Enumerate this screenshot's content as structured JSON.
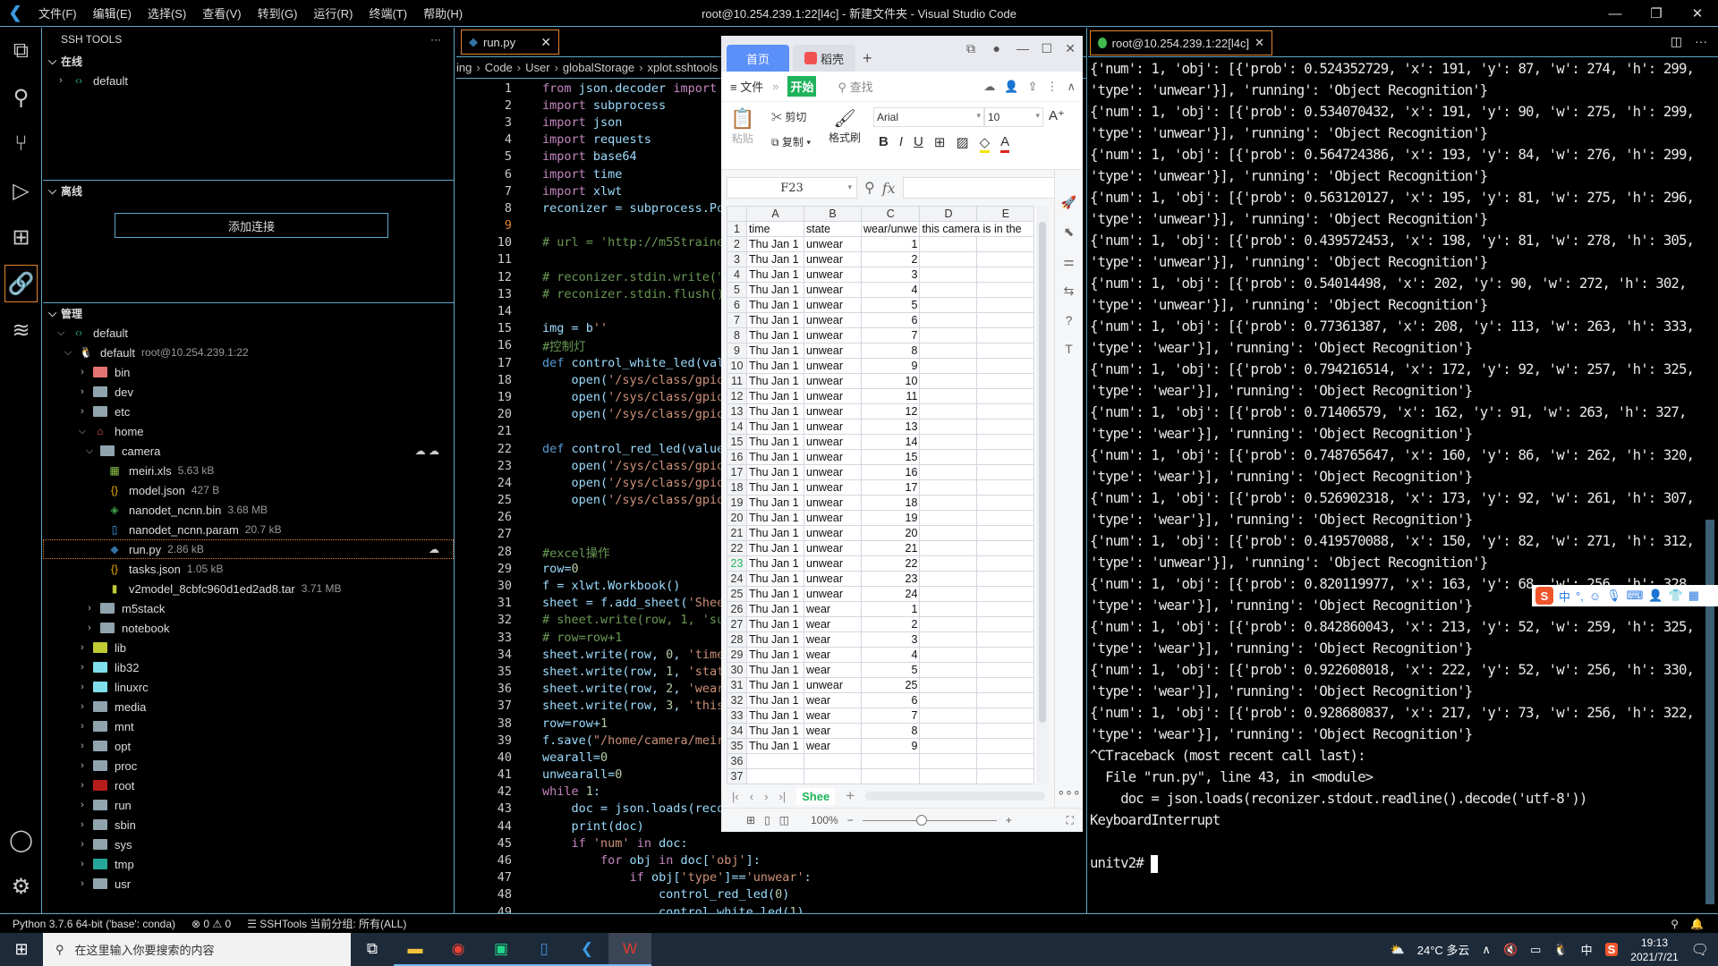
{
  "window": {
    "title": "root@10.254.239.1:22[l4c] - 新建文件夹 - Visual Studio Code",
    "menus": [
      "文件(F)",
      "编辑(E)",
      "选择(S)",
      "查看(V)",
      "转到(G)",
      "运行(R)",
      "终端(T)",
      "帮助(H)"
    ],
    "controls": {
      "minimize": "—",
      "restore": "❐",
      "close": "✕"
    }
  },
  "activity_bar": [
    "explorer-icon",
    "search-icon",
    "source-control-icon",
    "run-debug-icon",
    "extensions-icon",
    "ssh-link-icon",
    "layers-icon",
    "account-icon",
    "settings-gear-icon"
  ],
  "sidebar": {
    "title": "SSH TOOLS",
    "more": "···",
    "online": {
      "label": "在线",
      "items": [
        {
          "label": "default"
        }
      ]
    },
    "offline": {
      "label": "离线",
      "add_button": "添加连接"
    },
    "manage": {
      "label": "管理",
      "group": "default",
      "host": {
        "label": "default",
        "detail": "root@10.254.239.1:22"
      },
      "tree": [
        {
          "name": "bin",
          "depth": 0,
          "kind": "folder-bin",
          "open": false
        },
        {
          "name": "dev",
          "depth": 0,
          "kind": "folder",
          "open": false
        },
        {
          "name": "etc",
          "depth": 0,
          "kind": "folder",
          "open": false
        },
        {
          "name": "home",
          "depth": 0,
          "kind": "home",
          "open": true
        },
        {
          "name": "camera",
          "depth": 1,
          "kind": "folder",
          "open": true
        },
        {
          "name": "meiri.xls",
          "depth": 2,
          "kind": "xls",
          "size": "5.63 kB"
        },
        {
          "name": "model.json",
          "depth": 2,
          "kind": "json",
          "size": "427 B"
        },
        {
          "name": "nanodet_ncnn.bin",
          "depth": 2,
          "kind": "bin",
          "size": "3.68 MB"
        },
        {
          "name": "nanodet_ncnn.param",
          "depth": 2,
          "kind": "file",
          "size": "20.7 kB"
        },
        {
          "name": "run.py",
          "depth": 2,
          "kind": "py",
          "size": "2.86 kB",
          "selected": true
        },
        {
          "name": "tasks.json",
          "depth": 2,
          "kind": "json",
          "size": "1.05 kB"
        },
        {
          "name": "v2model_8cbfc960d1ed2ad8.tar",
          "depth": 2,
          "kind": "tar",
          "size": "3.71 MB"
        },
        {
          "name": "m5stack",
          "depth": 1,
          "kind": "folder",
          "open": false
        },
        {
          "name": "notebook",
          "depth": 1,
          "kind": "folder",
          "open": false
        },
        {
          "name": "lib",
          "depth": 0,
          "kind": "folder-lib",
          "open": false
        },
        {
          "name": "lib32",
          "depth": 0,
          "kind": "folder-link",
          "open": false
        },
        {
          "name": "linuxrc",
          "depth": 0,
          "kind": "folder-link",
          "open": false
        },
        {
          "name": "media",
          "depth": 0,
          "kind": "folder",
          "open": false
        },
        {
          "name": "mnt",
          "depth": 0,
          "kind": "folder",
          "open": false
        },
        {
          "name": "opt",
          "depth": 0,
          "kind": "folder",
          "open": false
        },
        {
          "name": "proc",
          "depth": 0,
          "kind": "folder",
          "open": false
        },
        {
          "name": "root",
          "depth": 0,
          "kind": "folder-root",
          "open": false
        },
        {
          "name": "run",
          "depth": 0,
          "kind": "folder",
          "open": false
        },
        {
          "name": "sbin",
          "depth": 0,
          "kind": "folder",
          "open": false
        },
        {
          "name": "sys",
          "depth": 0,
          "kind": "folder",
          "open": false
        },
        {
          "name": "tmp",
          "depth": 0,
          "kind": "folder-tmp",
          "open": false
        },
        {
          "name": "usr",
          "depth": 0,
          "kind": "folder",
          "open": false
        }
      ]
    }
  },
  "editor": {
    "tab": {
      "label": "run.py",
      "close": "✕"
    },
    "breadcrumb": [
      "ing",
      "Code",
      "User",
      "globalStorage",
      "xplot.sshtools"
    ],
    "current_line": 9,
    "lines": [
      "from json.decoder import JSONDecodeError",
      "import subprocess",
      "import json",
      "import requests",
      "import base64",
      "import time",
      "import xlwt",
      "reconizer = subprocess.Popen(",
      "",
      "# url = 'http://m5Strainer-cont",
      "",
      "# reconizer.stdin.write(\"_{\\\"s",
      "# reconizer.stdin.flush()",
      "",
      "img = b''",
      "#控制灯",
      "def control_white_led(value):",
      "    open('/sys/class/gpio/expo",
      "    open('/sys/class/gpio/gpio",
      "    open('/sys/class/gpio/gpio",
      "",
      "def control_red_led(value):",
      "    open('/sys/class/gpio/expo",
      "    open('/sys/class/gpio/gpio",
      "    open('/sys/class/gpio/gpio",
      "",
      "",
      "#excel操作",
      "row=0",
      "f = xlwt.Workbook()",
      "sheet = f.add_sheet('Sheet')",
      "# sheet.write(row, 1, 'succeed",
      "# row=row+1",
      "sheet.write(row, 0, 'time')",
      "sheet.write(row, 1, 'state')",
      "sheet.write(row, 2, 'wear/unwe",
      "sheet.write(row, 3, 'this came",
      "row=row+1",
      "f.save(\"/home/camera/meiri.xls",
      "wearall=0",
      "unwearall=0",
      "while 1:",
      "    doc = json.loads(reconizer",
      "    print(doc)",
      "    if 'num' in doc:",
      "        for obj in doc['obj']:",
      "            if obj['type']=='unwear':",
      "                control_red_led(0)",
      "                control_white_led(1)"
    ]
  },
  "wps": {
    "tabs": {
      "home": "首页",
      "doc": "稻壳",
      "new": "+"
    },
    "menubar": {
      "file": "≡ 文件",
      "more": "»",
      "start": "开始",
      "find": "查找"
    },
    "ribbon": {
      "paste": "粘贴",
      "cut": "剪切",
      "copy": "复制",
      "format_painter": "格式刷",
      "font": "Arial",
      "size": "10"
    },
    "namebox": "F23",
    "fx": "fx",
    "columns": [
      "A",
      "B",
      "C",
      "D",
      "E"
    ],
    "header_row": [
      "time",
      "state",
      "wear/unwe",
      "this camera is in the",
      ""
    ],
    "rows": [
      [
        "Thu Jan  1",
        "unwear",
        "1"
      ],
      [
        "Thu Jan  1",
        "unwear",
        "2"
      ],
      [
        "Thu Jan  1",
        "unwear",
        "3"
      ],
      [
        "Thu Jan  1",
        "unwear",
        "4"
      ],
      [
        "Thu Jan  1",
        "unwear",
        "5"
      ],
      [
        "Thu Jan  1",
        "unwear",
        "6"
      ],
      [
        "Thu Jan  1",
        "unwear",
        "7"
      ],
      [
        "Thu Jan  1",
        "unwear",
        "8"
      ],
      [
        "Thu Jan  1",
        "unwear",
        "9"
      ],
      [
        "Thu Jan  1",
        "unwear",
        "10"
      ],
      [
        "Thu Jan  1",
        "unwear",
        "11"
      ],
      [
        "Thu Jan  1",
        "unwear",
        "12"
      ],
      [
        "Thu Jan  1",
        "unwear",
        "13"
      ],
      [
        "Thu Jan  1",
        "unwear",
        "14"
      ],
      [
        "Thu Jan  1",
        "unwear",
        "15"
      ],
      [
        "Thu Jan  1",
        "unwear",
        "16"
      ],
      [
        "Thu Jan  1",
        "unwear",
        "17"
      ],
      [
        "Thu Jan  1",
        "unwear",
        "18"
      ],
      [
        "Thu Jan  1",
        "unwear",
        "19"
      ],
      [
        "Thu Jan  1",
        "unwear",
        "20"
      ],
      [
        "Thu Jan  1",
        "unwear",
        "21"
      ],
      [
        "Thu Jan  1",
        "unwear",
        "22"
      ],
      [
        "Thu Jan  1",
        "unwear",
        "23"
      ],
      [
        "Thu Jan  1",
        "unwear",
        "24"
      ],
      [
        "Thu Jan  1",
        "wear",
        "1"
      ],
      [
        "Thu Jan  1",
        "wear",
        "2"
      ],
      [
        "Thu Jan  1",
        "wear",
        "3"
      ],
      [
        "Thu Jan  1",
        "wear",
        "4"
      ],
      [
        "Thu Jan  1",
        "wear",
        "5"
      ],
      [
        "Thu Jan  1",
        "unwear",
        "25"
      ],
      [
        "Thu Jan  1",
        "wear",
        "6"
      ],
      [
        "Thu Jan  1",
        "wear",
        "7"
      ],
      [
        "Thu Jan  1",
        "wear",
        "8"
      ],
      [
        "Thu Jan  1",
        "wear",
        "9"
      ],
      [
        "",
        "",
        ""
      ],
      [
        "",
        "",
        ""
      ],
      [
        "",
        "",
        ""
      ]
    ],
    "active_row": 23,
    "sheet_tab": "Shee",
    "zoom": "100%"
  },
  "terminal": {
    "tab": "root@10.254.239.1:22[l4c]",
    "output": "{'num': 1, 'obj': [{'prob': 0.524352729, 'x': 191, 'y': 87, 'w': 274, 'h': 299, 'type': 'unwear'}], 'running': 'Object Recognition'}\n{'num': 1, 'obj': [{'prob': 0.534070432, 'x': 191, 'y': 90, 'w': 275, 'h': 299, 'type': 'unwear'}], 'running': 'Object Recognition'}\n{'num': 1, 'obj': [{'prob': 0.564724386, 'x': 193, 'y': 84, 'w': 276, 'h': 299, 'type': 'unwear'}], 'running': 'Object Recognition'}\n{'num': 1, 'obj': [{'prob': 0.563120127, 'x': 195, 'y': 81, 'w': 275, 'h': 296, 'type': 'unwear'}], 'running': 'Object Recognition'}\n{'num': 1, 'obj': [{'prob': 0.439572453, 'x': 198, 'y': 81, 'w': 278, 'h': 305, 'type': 'unwear'}], 'running': 'Object Recognition'}\n{'num': 1, 'obj': [{'prob': 0.54014498, 'x': 202, 'y': 90, 'w': 272, 'h': 302, 'type': 'unwear'}], 'running': 'Object Recognition'}\n{'num': 1, 'obj': [{'prob': 0.77361387, 'x': 208, 'y': 113, 'w': 263, 'h': 333, 'type': 'wear'}], 'running': 'Object Recognition'}\n{'num': 1, 'obj': [{'prob': 0.794216514, 'x': 172, 'y': 92, 'w': 257, 'h': 325, 'type': 'wear'}], 'running': 'Object Recognition'}\n{'num': 1, 'obj': [{'prob': 0.71406579, 'x': 162, 'y': 91, 'w': 263, 'h': 327, 'type': 'wear'}], 'running': 'Object Recognition'}\n{'num': 1, 'obj': [{'prob': 0.748765647, 'x': 160, 'y': 86, 'w': 262, 'h': 320, 'type': 'wear'}], 'running': 'Object Recognition'}\n{'num': 1, 'obj': [{'prob': 0.526902318, 'x': 173, 'y': 92, 'w': 261, 'h': 307, 'type': 'wear'}], 'running': 'Object Recognition'}\n{'num': 1, 'obj': [{'prob': 0.419570088, 'x': 150, 'y': 82, 'w': 271, 'h': 312, 'type': 'unwear'}], 'running': 'Object Recognition'}\n{'num': 1, 'obj': [{'prob': 0.820119977, 'x': 163, 'y': 68, 'w': 256, 'h': 328, 'type': 'wear'}], 'running': 'Object Recognition'}\n{'num': 1, 'obj': [{'prob': 0.842860043, 'x': 213, 'y': 52, 'w': 259, 'h': 325, 'type': 'wear'}], 'running': 'Object Recognition'}\n{'num': 1, 'obj': [{'prob': 0.922608018, 'x': 222, 'y': 52, 'w': 256, 'h': 330, 'type': 'wear'}], 'running': 'Object Recognition'}\n{'num': 1, 'obj': [{'prob': 0.928680837, 'x': 217, 'y': 73, 'w': 256, 'h': 322, 'type': 'wear'}], 'running': 'Object Recognition'}\n^CTraceback (most recent call last):\n  File \"run.py\", line 43, in <module>\n    doc = json.loads(reconizer.stdout.readline().decode('utf-8'))\nKeyboardInterrupt\n\n",
    "prompt": "unitv2# "
  },
  "ime": {
    "label": "中"
  },
  "statusbar": {
    "python": "Python 3.7.6 64-bit ('base': conda)",
    "problems": "⊗ 0 ⚠ 0",
    "sshtools": "☰ SSHTools 当前分组: 所有(ALL)"
  },
  "taskbar": {
    "search_placeholder": "在这里输入你要搜索的内容",
    "weather": "24°C 多云",
    "ime": "中",
    "time": "19:13",
    "date": "2021/7/21"
  }
}
